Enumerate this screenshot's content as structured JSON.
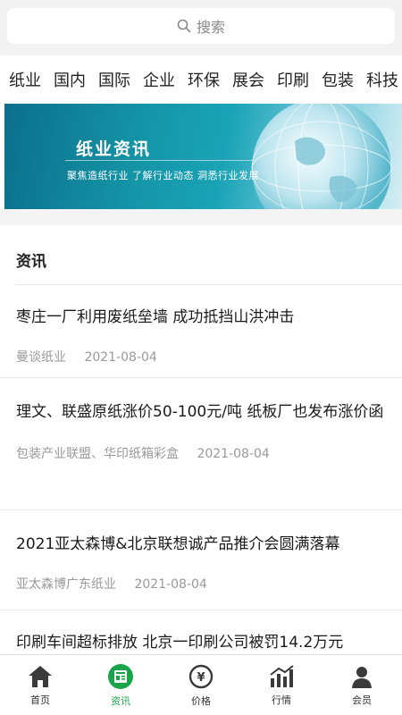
{
  "search": {
    "placeholder": "搜索"
  },
  "categories": [
    "纸业",
    "国内",
    "国际",
    "企业",
    "环保",
    "展会",
    "印刷",
    "包装",
    "科技"
  ],
  "banner": {
    "title": "纸业资讯",
    "subtitle": "聚焦造纸行业  了解行业动态  洞悉行业发展"
  },
  "section": {
    "title": "资讯"
  },
  "news": [
    {
      "title": "枣庄一厂利用废纸垒墙 成功抵挡山洪冲击",
      "source": "曼谈纸业",
      "date": "2021-08-04"
    },
    {
      "title": "理文、联盛原纸涨价50-100元/吨 纸板厂也发布涨价函",
      "source": "包装产业联盟、华印纸箱彩盒",
      "date": "2021-08-04"
    },
    {
      "title": "2021亚太森博&北京联想诚产品推介会圆满落幕",
      "source": "亚太森博广东纸业",
      "date": "2021-08-04"
    },
    {
      "title": "印刷车间超标排放 北京一印刷公司被罚14.2万元",
      "source": "",
      "date": ""
    }
  ],
  "nav": [
    {
      "label": "首页",
      "icon": "home-icon"
    },
    {
      "label": "资讯",
      "icon": "news-icon",
      "active": true
    },
    {
      "label": "价格",
      "icon": "price-icon"
    },
    {
      "label": "行情",
      "icon": "chart-icon"
    },
    {
      "label": "会员",
      "icon": "member-icon"
    }
  ],
  "colors": {
    "accent": "#19a44a",
    "banner": "#1595a8",
    "background": "#f4f4f4"
  }
}
